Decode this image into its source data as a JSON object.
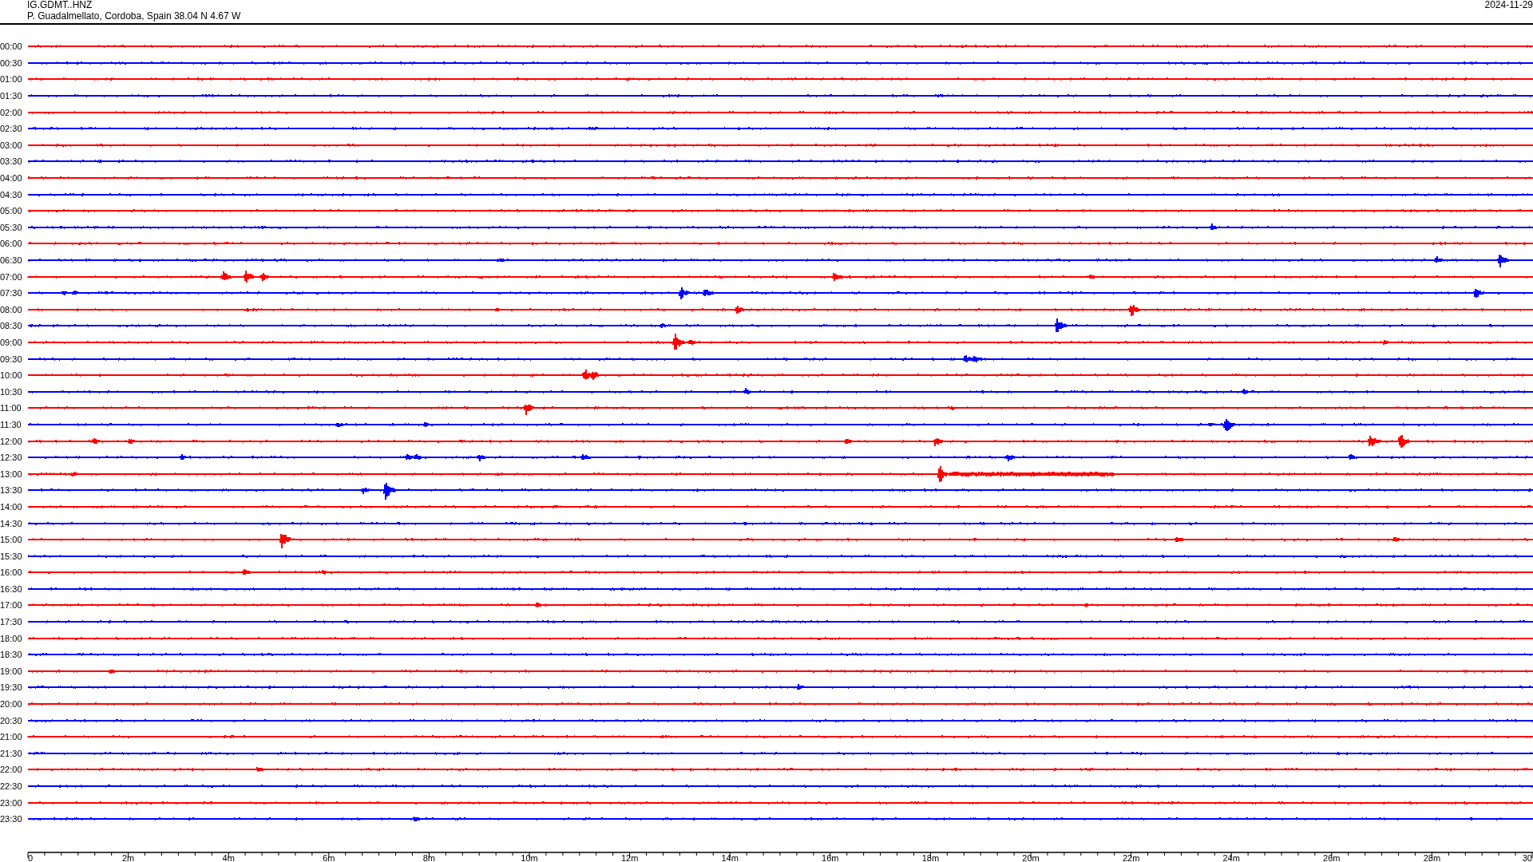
{
  "header": {
    "station": "IG.GDMT..HNZ",
    "location": "P. Guadalmellato, Cordoba, Spain  38.04 N 4.67 W",
    "date": "2024-11-29"
  },
  "rows": [
    {
      "time": "00:00",
      "color": "#ff0000"
    },
    {
      "time": "00:30",
      "color": "#0000ff"
    },
    {
      "time": "01:00",
      "color": "#ff0000"
    },
    {
      "time": "01:30",
      "color": "#0000ff"
    },
    {
      "time": "02:00",
      "color": "#ff0000"
    },
    {
      "time": "02:30",
      "color": "#0000ff"
    },
    {
      "time": "03:00",
      "color": "#ff0000"
    },
    {
      "time": "03:30",
      "color": "#0000ff"
    },
    {
      "time": "04:00",
      "color": "#ff0000"
    },
    {
      "time": "04:30",
      "color": "#0000ff"
    },
    {
      "time": "05:00",
      "color": "#ff0000"
    },
    {
      "time": "05:30",
      "color": "#0000ff"
    },
    {
      "time": "06:00",
      "color": "#ff0000"
    },
    {
      "time": "06:30",
      "color": "#0000ff"
    },
    {
      "time": "07:00",
      "color": "#ff0000"
    },
    {
      "time": "07:30",
      "color": "#0000ff"
    },
    {
      "time": "08:00",
      "color": "#ff0000"
    },
    {
      "time": "08:30",
      "color": "#0000ff"
    },
    {
      "time": "09:00",
      "color": "#ff0000"
    },
    {
      "time": "09:30",
      "color": "#0000ff"
    },
    {
      "time": "10:00",
      "color": "#ff0000"
    },
    {
      "time": "10:30",
      "color": "#0000ff"
    },
    {
      "time": "11:00",
      "color": "#ff0000"
    },
    {
      "time": "11:30",
      "color": "#0000ff"
    },
    {
      "time": "12:00",
      "color": "#ff0000"
    },
    {
      "time": "12:30",
      "color": "#0000ff"
    },
    {
      "time": "13:00",
      "color": "#ff0000"
    },
    {
      "time": "13:30",
      "color": "#0000ff"
    },
    {
      "time": "14:00",
      "color": "#ff0000"
    },
    {
      "time": "14:30",
      "color": "#0000ff"
    },
    {
      "time": "15:00",
      "color": "#ff0000"
    },
    {
      "time": "15:30",
      "color": "#0000ff"
    },
    {
      "time": "16:00",
      "color": "#ff0000"
    },
    {
      "time": "16:30",
      "color": "#0000ff"
    },
    {
      "time": "17:00",
      "color": "#ff0000"
    },
    {
      "time": "17:30",
      "color": "#0000ff"
    },
    {
      "time": "18:00",
      "color": "#ff0000"
    },
    {
      "time": "18:30",
      "color": "#0000ff"
    },
    {
      "time": "19:00",
      "color": "#ff0000"
    },
    {
      "time": "19:30",
      "color": "#0000ff"
    },
    {
      "time": "20:00",
      "color": "#ff0000"
    },
    {
      "time": "20:30",
      "color": "#0000ff"
    },
    {
      "time": "21:00",
      "color": "#ff0000"
    },
    {
      "time": "21:30",
      "color": "#0000ff"
    },
    {
      "time": "22:00",
      "color": "#ff0000"
    },
    {
      "time": "22:30",
      "color": "#0000ff"
    },
    {
      "time": "23:00",
      "color": "#ff0000"
    },
    {
      "time": "23:30",
      "color": "#0000ff"
    }
  ],
  "x_axis": {
    "ticks": [
      "0",
      "2m",
      "4m",
      "6m",
      "8m",
      "10m",
      "12m",
      "14m",
      "16m",
      "18m",
      "20m",
      "22m",
      "24m",
      "26m",
      "28m",
      "30"
    ]
  }
}
